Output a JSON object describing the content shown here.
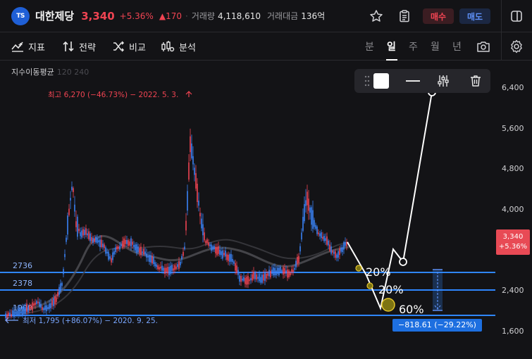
{
  "header": {
    "logo_text": "TS",
    "stock_name": "대한제당",
    "price": "3,340",
    "change_pct": "+5.36%",
    "change_amt": "▲170",
    "volume_label": "거래량",
    "volume": "4,118,610",
    "trade_value_label": "거래대금",
    "trade_value": "136억",
    "buy_label": "매수",
    "sell_label": "매도"
  },
  "toolbar": {
    "indicators": "지표",
    "strategy": "전략",
    "compare": "비교",
    "analysis": "분석",
    "periods": [
      "분",
      "일",
      "주",
      "월",
      "년"
    ],
    "active_period": "일"
  },
  "chart": {
    "ma_label": "지수이동평균",
    "ma_inactive": "120 240",
    "high_annotation": "최고 6,270 (−46.73%) − 2022. 5. 3.",
    "low_annotation": "최저 1,795 (+86.07%) − 2020. 9. 25.",
    "y_ticks": [
      "6,400",
      "5,600",
      "4,800",
      "4,000",
      "3,340",
      "2,400",
      "1,600"
    ],
    "current_price_tag": "3,340",
    "current_change_tag": "+5.36%",
    "level_lines": [
      "2736",
      "2378",
      "1900"
    ],
    "pattern_labels": [
      "20%",
      "20%",
      "60%"
    ],
    "drawdown_badge": "−818.61 (−29.22%)"
  },
  "colors": {
    "up": "#f04452",
    "down": "#3b82f6",
    "level_line": "#2f86ff",
    "background": "#131316"
  }
}
